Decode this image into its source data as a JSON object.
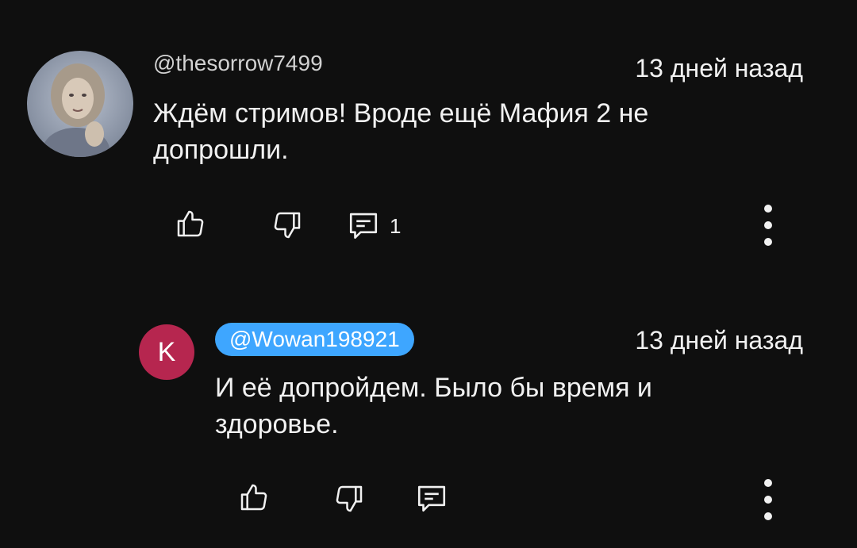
{
  "comment": {
    "author": "@thesorrow7499",
    "time": "13 дней назад",
    "text_line1": "Ждём стримов! Вроде ещё Мафия 2 не",
    "text_line2": "допрошли.",
    "reply_count": "1",
    "icons": {
      "like": "thumb-up-icon",
      "dislike": "thumb-down-icon",
      "reply": "comment-icon",
      "more": "more-vertical-icon"
    }
  },
  "reply": {
    "avatar_letter": "K",
    "avatar_color": "#b6264f",
    "author": "@Wowan198921",
    "author_chip_color": "#3ea6ff",
    "time": "13 дней назад",
    "text_line1": "И её допройдем. Было бы время и",
    "text_line2": "здоровье."
  },
  "colors": {
    "background": "#0f0f0f",
    "text": "#f1f1f1",
    "author_text": "#d2d2d2"
  }
}
